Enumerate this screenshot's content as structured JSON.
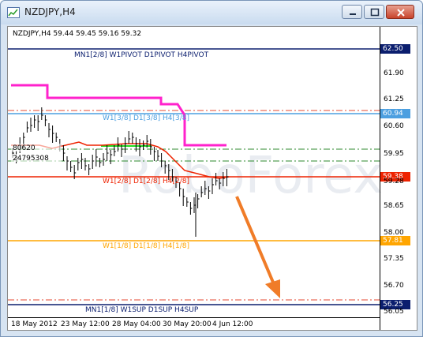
{
  "window": {
    "title": "NZDJPY,H4",
    "colors": {
      "frame": "#d7e4f2",
      "close": "#c8432b"
    },
    "icons": [
      "chart-icon",
      "minimize-icon",
      "maximize-icon",
      "close-icon"
    ]
  },
  "chart": {
    "info_line": "NZDJPY,H4  59.44 59.45 59.16 59.32",
    "watermark": "RoboForex",
    "levels": [
      {
        "label": "MN1[2/8] W1PIVOT D1PIVOT H4PIVOT",
        "price": "62.50",
        "color": "#0b1e6e"
      },
      {
        "label": "W1[3/8] D1[3/8] H4[3/8]",
        "price": "60.94",
        "color": "#4c9fe0"
      },
      {
        "label": "W1[2/8] D1[2/8] H4[2/8]",
        "price": "59.38",
        "color": "#ee2200"
      },
      {
        "label": "W1[1/8] D1[1/8] H4[1/8]",
        "price": "57.81",
        "color": "#ffa500"
      },
      {
        "label": "MN1[1/8] W1SUP D1SUP H4SUP",
        "price": "56.25",
        "color": "#0b1e6e"
      }
    ],
    "price_ticks": [
      "61.90",
      "61.25",
      "60.60",
      "59.95",
      "59.28",
      "58.65",
      "58.00",
      "57.35",
      "56.70",
      "56.05"
    ],
    "time_ticks": [
      "18 May 2012",
      "23 May 12:00",
      "28 May 04:00",
      "30 May 20:00",
      "4 Jun 12:00"
    ],
    "left_labels": [
      "80620",
      "24795308"
    ],
    "forecast_arrow": {
      "color": "#f07c28",
      "direction": "down"
    }
  }
}
